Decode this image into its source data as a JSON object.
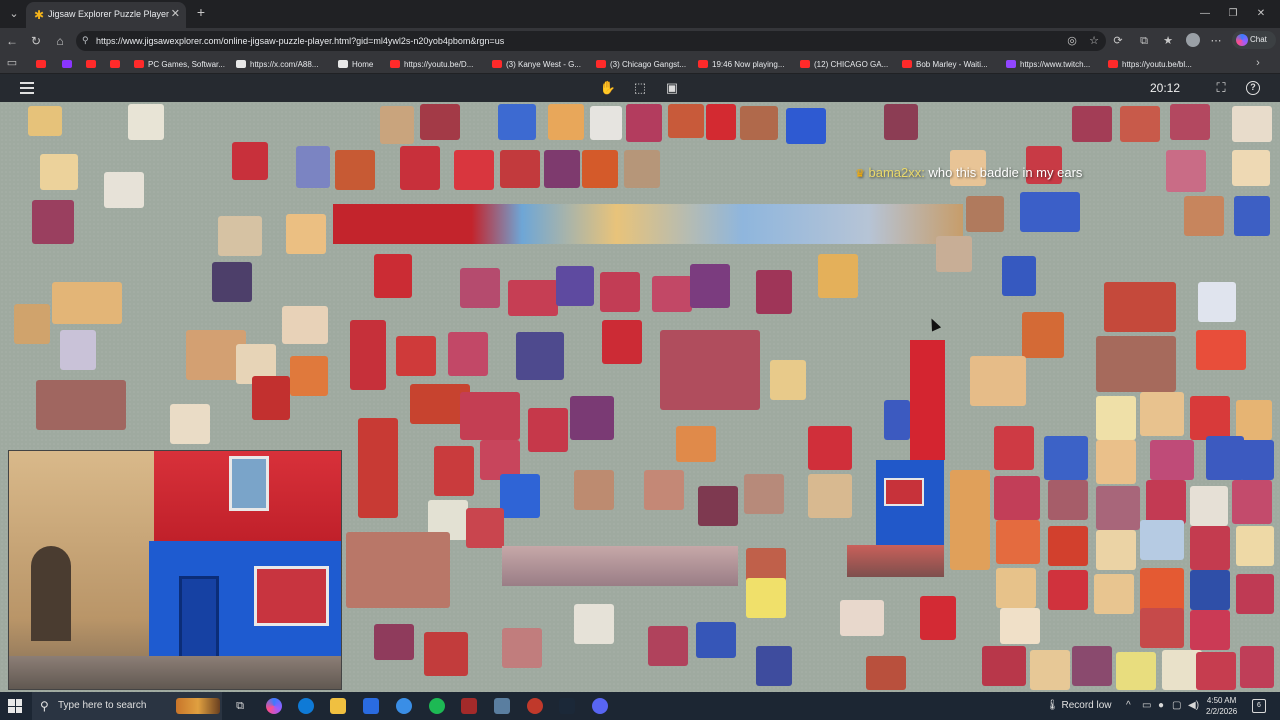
{
  "browser": {
    "tab_title": "Jigsaw Explorer Puzzle Player",
    "url": "https://www.jigsawexplorer.com/online-jigsaw-puzzle-player.html?gid=ml4ywl2s-n20yob4pbom&rgn=us",
    "chat_label": "Chat",
    "bookmarks": [
      {
        "label": "",
        "color": "#ff2a2a"
      },
      {
        "label": "",
        "color": "#8a35ff"
      },
      {
        "label": "",
        "color": "#ff2a2a"
      },
      {
        "label": "",
        "color": "#ff2a2a"
      },
      {
        "label": "PC Games, Softwar...",
        "color": "#ff2a2a"
      },
      {
        "label": "https://x.com/A88...",
        "color": "#e8e8e8"
      },
      {
        "label": "Home",
        "color": "#e8e8e8"
      },
      {
        "label": "https://youtu.be/D...",
        "color": "#ff2a2a"
      },
      {
        "label": "(3) Kanye West - G...",
        "color": "#ff2a2a"
      },
      {
        "label": "(3) Chicago Gangst...",
        "color": "#ff2a2a"
      },
      {
        "label": "19:46 Now playing...",
        "color": "#ff2a2a"
      },
      {
        "label": "(12) CHICAGO GA...",
        "color": "#ff2a2a"
      },
      {
        "label": "Bob Marley - Waiti...",
        "color": "#ff2a2a"
      },
      {
        "label": "https://www.twitch...",
        "color": "#9146ff"
      },
      {
        "label": "https://youtu.be/bl...",
        "color": "#ff2a2a"
      }
    ]
  },
  "puzzle": {
    "timer": "20:12",
    "help_label": "?",
    "chat_message": {
      "user": "bama2xx:",
      "text": "who this baddie in my ears"
    }
  },
  "taskbar": {
    "search_placeholder": "Type here to search",
    "record_label": "Record low",
    "time": "4:50 AM",
    "date": "2/2/2026",
    "notif_count": "6"
  }
}
